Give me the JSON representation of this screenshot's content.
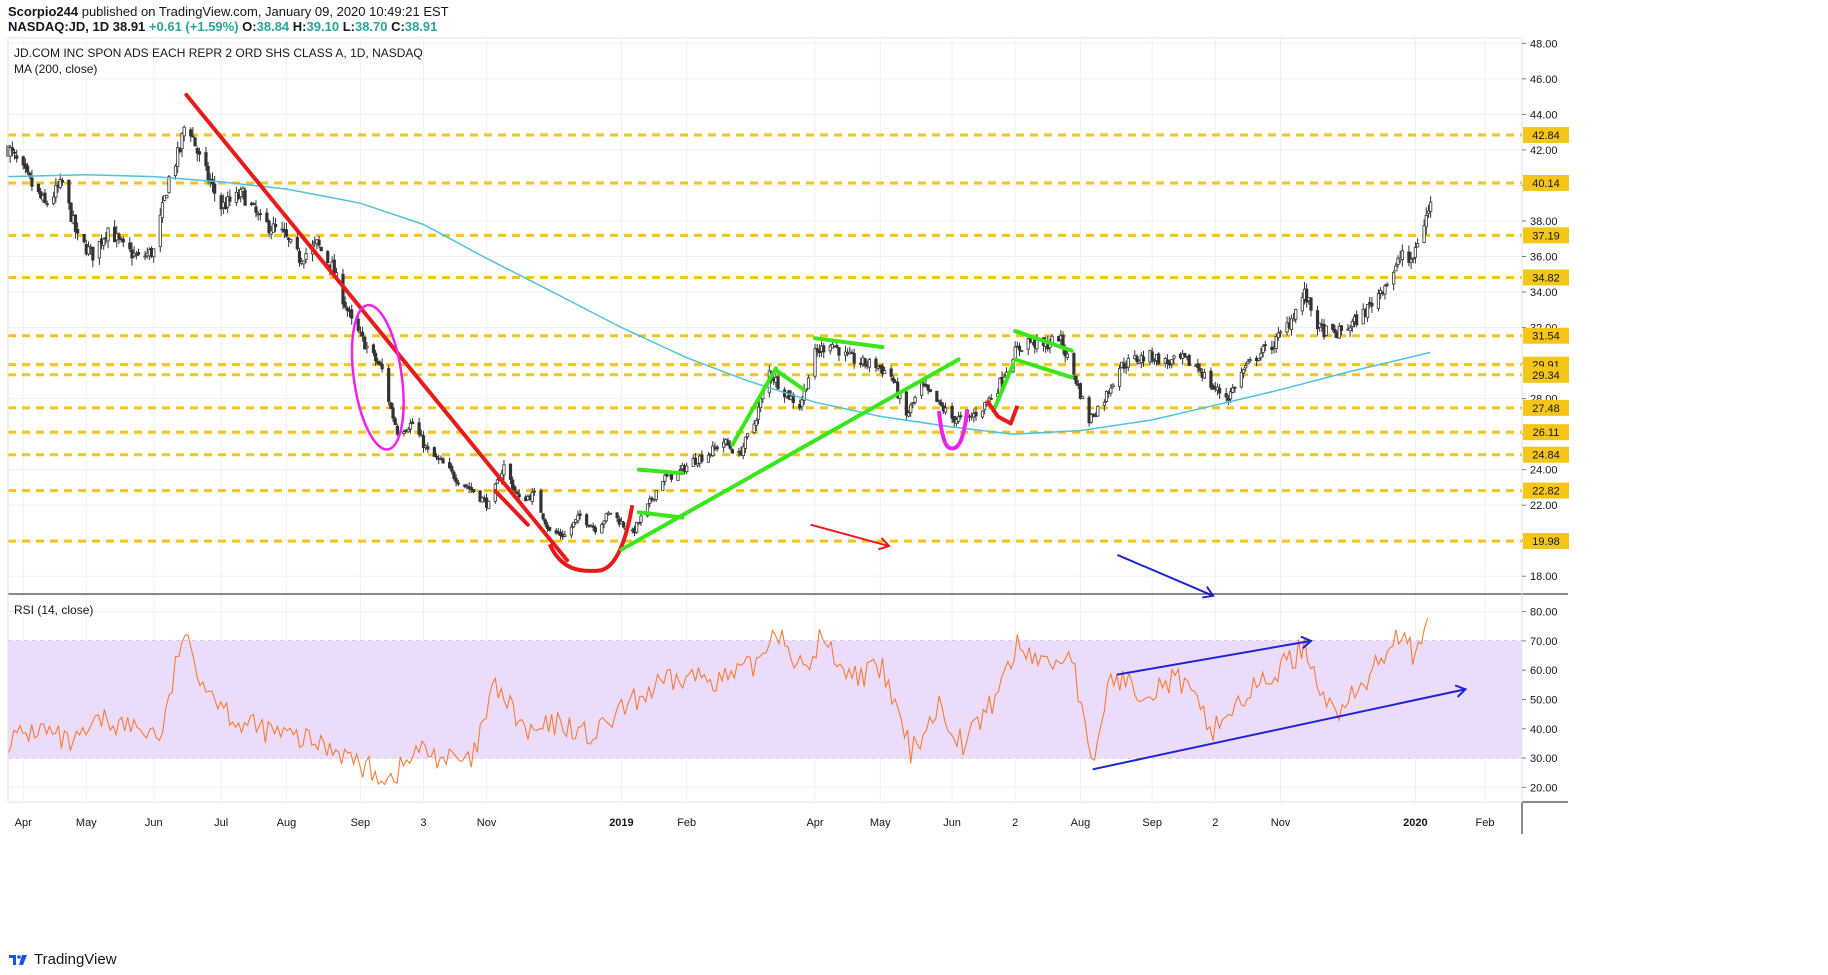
{
  "header": {
    "publisher": "Scorpio244",
    "published_text": "published on TradingView.com, January 09, 2020 10:49:21 EST",
    "symbol": "NASDAQ:JD, 1D",
    "last": "38.91",
    "change": "+0.61 (+1.59%)",
    "open_label": "O:",
    "open": "38.84",
    "high_label": "H:",
    "high": "39.10",
    "low_label": "L:",
    "low": "38.70",
    "close_label": "C:",
    "close": "38.91"
  },
  "legend": {
    "title": "JD.COM INC SPON ADS EACH REPR 2 ORD SHS CLASS A, 1D, NASDAQ",
    "ma": "MA (200, close)",
    "rsi": "RSI (14, close)"
  },
  "footer": {
    "brand": "TradingView",
    "logo_icon": "tradingview-logo-icon"
  },
  "colors": {
    "up": "#26a69a",
    "down": "#ef5350",
    "candle": "#444444",
    "ma": "#4fc3d9",
    "level": "#f5c518",
    "red_line": "#e81b1b",
    "green_line": "#39e619",
    "magenta": "#ee22ee",
    "blue_line": "#1f22d6",
    "rsi": "#f57c35",
    "rsi_band": "#ecdcfb",
    "grid": "#eef0f3"
  },
  "chart_data": {
    "type": "line",
    "price_axis": {
      "ylim": [
        17,
        48.3
      ],
      "ticks": [
        "48.00",
        "46.00",
        "44.00",
        "42.00",
        "40.00",
        "38.00",
        "36.00",
        "34.00",
        "32.00",
        "30.00",
        "28.00",
        "26.00",
        "24.00",
        "22.00",
        "20.00",
        "18.00"
      ]
    },
    "x_axis": {
      "labels": [
        {
          "text": "Apr",
          "date": "2018-04-02"
        },
        {
          "text": "May",
          "date": "2018-05-01"
        },
        {
          "text": "Jun",
          "date": "2018-06-01"
        },
        {
          "text": "Jul",
          "date": "2018-07-02"
        },
        {
          "text": "Aug",
          "date": "2018-08-01"
        },
        {
          "text": "Sep",
          "date": "2018-09-04"
        },
        {
          "text": "3",
          "date": "2018-10-03"
        },
        {
          "text": "Nov",
          "date": "2018-11-01"
        },
        {
          "text": "2019",
          "date": "2019-01-02"
        },
        {
          "text": "Feb",
          "date": "2019-02-01"
        },
        {
          "text": "Apr",
          "date": "2019-04-01"
        },
        {
          "text": "May",
          "date": "2019-05-01"
        },
        {
          "text": "Jun",
          "date": "2019-06-03"
        },
        {
          "text": "2",
          "date": "2019-07-02"
        },
        {
          "text": "Aug",
          "date": "2019-08-01"
        },
        {
          "text": "Sep",
          "date": "2019-09-03"
        },
        {
          "text": "2",
          "date": "2019-10-02"
        },
        {
          "text": "Nov",
          "date": "2019-11-01"
        },
        {
          "text": "2020",
          "date": "2020-01-02"
        },
        {
          "text": "Feb",
          "date": "2020-02-03"
        }
      ]
    },
    "levels": [
      "42.84",
      "40.14",
      "37.19",
      "34.82",
      "31.54",
      "29.91",
      "29.34",
      "27.48",
      "26.11",
      "24.84",
      "22.82",
      "19.98"
    ],
    "price_path": [
      [
        "2018-03-26",
        42.1
      ],
      [
        "2018-04-05",
        40.2
      ],
      [
        "2018-04-12",
        38.9
      ],
      [
        "2018-04-20",
        40.1
      ],
      [
        "2018-04-27",
        37.0
      ],
      [
        "2018-05-04",
        36.1
      ],
      [
        "2018-05-11",
        37.6
      ],
      [
        "2018-05-18",
        36.5
      ],
      [
        "2018-05-25",
        35.9
      ],
      [
        "2018-06-01",
        36.3
      ],
      [
        "2018-06-08",
        40.4
      ],
      [
        "2018-06-13",
        42.0
      ],
      [
        "2018-06-16",
        43.9
      ],
      [
        "2018-06-22",
        41.5
      ],
      [
        "2018-07-02",
        38.8
      ],
      [
        "2018-07-12",
        39.5
      ],
      [
        "2018-07-20",
        38.0
      ],
      [
        "2018-07-30",
        37.3
      ],
      [
        "2018-08-07",
        35.9
      ],
      [
        "2018-08-15",
        36.7
      ],
      [
        "2018-08-22",
        35.4
      ],
      [
        "2018-08-31",
        32.3
      ],
      [
        "2018-09-07",
        30.9
      ],
      [
        "2018-09-14",
        29.6
      ],
      [
        "2018-09-18",
        27.4
      ],
      [
        "2018-09-21",
        26.2
      ],
      [
        "2018-09-28",
        26.6
      ],
      [
        "2018-10-05",
        25.0
      ],
      [
        "2018-10-12",
        24.3
      ],
      [
        "2018-10-19",
        23.4
      ],
      [
        "2018-10-26",
        22.8
      ],
      [
        "2018-11-02",
        22.0
      ],
      [
        "2018-11-09",
        24.2
      ],
      [
        "2018-11-16",
        22.3
      ],
      [
        "2018-11-23",
        22.6
      ],
      [
        "2018-11-30",
        20.5
      ],
      [
        "2018-12-07",
        20.3
      ],
      [
        "2018-12-14",
        21.4
      ],
      [
        "2018-12-21",
        20.7
      ],
      [
        "2018-12-28",
        21.6
      ],
      [
        "2019-01-07",
        20.4
      ],
      [
        "2019-01-14",
        21.9
      ],
      [
        "2019-01-21",
        23.5
      ],
      [
        "2019-01-28",
        23.8
      ],
      [
        "2019-02-04",
        24.5
      ],
      [
        "2019-02-11",
        24.9
      ],
      [
        "2019-02-18",
        25.6
      ],
      [
        "2019-02-25",
        24.8
      ],
      [
        "2019-03-04",
        26.6
      ],
      [
        "2019-03-11",
        29.5
      ],
      [
        "2019-03-18",
        28.4
      ],
      [
        "2019-03-25",
        27.6
      ],
      [
        "2019-04-01",
        30.5
      ],
      [
        "2019-04-08",
        31.2
      ],
      [
        "2019-04-15",
        30.4
      ],
      [
        "2019-04-22",
        30.0
      ],
      [
        "2019-04-29",
        29.9
      ],
      [
        "2019-05-06",
        29.3
      ],
      [
        "2019-05-13",
        27.0
      ],
      [
        "2019-05-20",
        28.7
      ],
      [
        "2019-05-27",
        27.8
      ],
      [
        "2019-06-03",
        26.9
      ],
      [
        "2019-06-10",
        26.8
      ],
      [
        "2019-06-17",
        27.5
      ],
      [
        "2019-06-24",
        28.6
      ],
      [
        "2019-07-01",
        30.5
      ],
      [
        "2019-07-08",
        31.3
      ],
      [
        "2019-07-15",
        30.9
      ],
      [
        "2019-07-22",
        31.5
      ],
      [
        "2019-07-29",
        29.4
      ],
      [
        "2019-08-05",
        26.8
      ],
      [
        "2019-08-12",
        28.0
      ],
      [
        "2019-08-19",
        29.8
      ],
      [
        "2019-08-26",
        30.2
      ],
      [
        "2019-09-03",
        30.4
      ],
      [
        "2019-09-10",
        30.0
      ],
      [
        "2019-09-17",
        30.2
      ],
      [
        "2019-09-24",
        29.8
      ],
      [
        "2019-10-01",
        28.6
      ],
      [
        "2019-10-08",
        28.1
      ],
      [
        "2019-10-15",
        29.6
      ],
      [
        "2019-10-22",
        30.5
      ],
      [
        "2019-10-29",
        31.1
      ],
      [
        "2019-11-05",
        32.3
      ],
      [
        "2019-11-12",
        33.9
      ],
      [
        "2019-11-19",
        31.9
      ],
      [
        "2019-11-26",
        31.6
      ],
      [
        "2019-12-03",
        32.1
      ],
      [
        "2019-12-10",
        32.9
      ],
      [
        "2019-12-17",
        34.1
      ],
      [
        "2019-12-24",
        35.3
      ],
      [
        "2019-12-27",
        36.3
      ],
      [
        "2019-12-31",
        35.5
      ],
      [
        "2020-01-03",
        36.9
      ],
      [
        "2020-01-09",
        38.91
      ]
    ],
    "ma200_path": [
      [
        "2018-03-26",
        40.5
      ],
      [
        "2018-05-01",
        40.6
      ],
      [
        "2018-06-01",
        40.5
      ],
      [
        "2018-07-02",
        40.2
      ],
      [
        "2018-08-01",
        39.8
      ],
      [
        "2018-09-04",
        39.0
      ],
      [
        "2018-10-03",
        37.8
      ],
      [
        "2018-11-01",
        35.9
      ],
      [
        "2018-12-03",
        33.9
      ],
      [
        "2019-01-02",
        32.0
      ],
      [
        "2019-02-01",
        30.3
      ],
      [
        "2019-03-01",
        29.0
      ],
      [
        "2019-04-01",
        27.8
      ],
      [
        "2019-05-01",
        27.0
      ],
      [
        "2019-06-03",
        26.4
      ],
      [
        "2019-07-01",
        26.0
      ],
      [
        "2019-08-01",
        26.2
      ],
      [
        "2019-09-03",
        26.8
      ],
      [
        "2019-10-01",
        27.6
      ],
      [
        "2019-11-01",
        28.5
      ],
      [
        "2019-12-02",
        29.5
      ],
      [
        "2020-01-09",
        30.6
      ]
    ],
    "rsi_axis": {
      "ylim": [
        15,
        86
      ],
      "ticks": [
        "80.00",
        "70.00",
        "60.00",
        "50.00",
        "40.00",
        "30.00",
        "20.00"
      ],
      "band": [
        30,
        70
      ]
    },
    "rsi_path": [
      [
        "2018-03-26",
        36
      ],
      [
        "2018-04-10",
        40
      ],
      [
        "2018-04-25",
        34
      ],
      [
        "2018-05-08",
        43
      ],
      [
        "2018-05-20",
        41
      ],
      [
        "2018-06-05",
        38
      ],
      [
        "2018-06-14",
        72
      ],
      [
        "2018-06-25",
        55
      ],
      [
        "2018-07-10",
        42
      ],
      [
        "2018-07-25",
        39
      ],
      [
        "2018-08-10",
        36
      ],
      [
        "2018-08-25",
        33
      ],
      [
        "2018-09-05",
        27
      ],
      [
        "2018-09-18",
        23
      ],
      [
        "2018-10-01",
        33
      ],
      [
        "2018-10-12",
        30
      ],
      [
        "2018-10-25",
        28
      ],
      [
        "2018-11-05",
        55
      ],
      [
        "2018-11-20",
        38
      ],
      [
        "2018-12-05",
        42
      ],
      [
        "2018-12-20",
        37
      ],
      [
        "2019-01-05",
        48
      ],
      [
        "2019-01-20",
        55
      ],
      [
        "2019-02-05",
        58
      ],
      [
        "2019-02-20",
        57
      ],
      [
        "2019-03-05",
        62
      ],
      [
        "2019-03-14",
        75
      ],
      [
        "2019-03-28",
        58
      ],
      [
        "2019-04-03",
        71
      ],
      [
        "2019-04-18",
        58
      ],
      [
        "2019-05-02",
        60
      ],
      [
        "2019-05-15",
        32
      ],
      [
        "2019-05-28",
        48
      ],
      [
        "2019-06-08",
        35
      ],
      [
        "2019-06-20",
        47
      ],
      [
        "2019-07-03",
        68
      ],
      [
        "2019-07-18",
        62
      ],
      [
        "2019-07-28",
        66
      ],
      [
        "2019-08-06",
        26
      ],
      [
        "2019-08-15",
        58
      ],
      [
        "2019-08-30",
        53
      ],
      [
        "2019-09-15",
        57
      ],
      [
        "2019-10-01",
        40
      ],
      [
        "2019-10-14",
        50
      ],
      [
        "2019-10-28",
        58
      ],
      [
        "2019-11-12",
        68
      ],
      [
        "2019-11-25",
        45
      ],
      [
        "2019-12-08",
        53
      ],
      [
        "2019-12-20",
        68
      ],
      [
        "2019-12-28",
        75
      ],
      [
        "2020-01-02",
        62
      ],
      [
        "2020-01-09",
        78
      ]
    ],
    "annotations": [
      {
        "kind": "line",
        "color": "red_line",
        "from": [
          "2018-06-16",
          45.1
        ],
        "to": [
          "2018-12-08",
          18.9
        ]
      },
      {
        "kind": "line",
        "color": "red_line",
        "from": [
          "2018-11-05",
          22.8
        ],
        "to": [
          "2018-11-20",
          20.9
        ]
      },
      {
        "kind": "curve",
        "color": "red_line",
        "from": [
          "2018-11-30",
          19.8
        ],
        "to": [
          "2019-01-07",
          22.0
        ],
        "bottom": [
          "2018-12-20",
          18.3
        ]
      },
      {
        "kind": "ellipse",
        "color": "magenta",
        "center": [
          "2018-09-12",
          29.2
        ],
        "half_days": 11,
        "half_price": 4.1
      },
      {
        "kind": "line",
        "color": "green_line",
        "from": [
          "2019-01-02",
          19.5
        ],
        "to": [
          "2019-06-06",
          30.2
        ]
      },
      {
        "kind": "line",
        "color": "green_line",
        "from": [
          "2019-01-10",
          24.0
        ],
        "to": [
          "2019-01-30",
          23.8
        ]
      },
      {
        "kind": "line",
        "color": "green_line",
        "from": [
          "2019-01-10",
          21.6
        ],
        "to": [
          "2019-01-30",
          21.3
        ]
      },
      {
        "kind": "line",
        "color": "green_line",
        "from": [
          "2019-02-22",
          25.4
        ],
        "to": [
          "2019-03-14",
          29.7
        ]
      },
      {
        "kind": "line",
        "color": "green_line",
        "from": [
          "2019-03-14",
          29.6
        ],
        "to": [
          "2019-03-27",
          28.5
        ]
      },
      {
        "kind": "line",
        "color": "green_line",
        "from": [
          "2019-04-01",
          31.4
        ],
        "to": [
          "2019-05-02",
          30.9
        ]
      },
      {
        "kind": "line",
        "color": "green_line",
        "from": [
          "2019-06-22",
          27.3
        ],
        "to": [
          "2019-07-01",
          29.9
        ]
      },
      {
        "kind": "line",
        "color": "green_line",
        "from": [
          "2019-07-02",
          31.8
        ],
        "to": [
          "2019-07-28",
          30.7
        ]
      },
      {
        "kind": "line",
        "color": "green_line",
        "from": [
          "2019-07-02",
          30.2
        ],
        "to": [
          "2019-07-28",
          29.2
        ]
      },
      {
        "kind": "curve",
        "color": "magenta",
        "from": [
          "2019-05-28",
          27.3
        ],
        "to": [
          "2019-06-10",
          27.4
        ],
        "bottom": [
          "2019-06-03",
          25.2
        ]
      },
      {
        "kind": "polyline",
        "color": "red_line",
        "points": [
          [
            "2019-06-19",
            27.9
          ],
          [
            "2019-06-24",
            27.0
          ],
          [
            "2019-06-30",
            26.6
          ],
          [
            "2019-07-03",
            27.6
          ]
        ]
      },
      {
        "kind": "arrow",
        "color": "red_line",
        "from": [
          "2019-03-30",
          20.9
        ],
        "to": [
          "2019-05-05",
          19.7
        ]
      },
      {
        "kind": "arrow",
        "color": "blue_line",
        "from": [
          "2019-08-18",
          19.2
        ],
        "to": [
          "2019-10-01",
          16.9
        ]
      }
    ],
    "rsi_annotations": [
      {
        "kind": "line",
        "color": "blue_line",
        "from": [
          "2019-08-18",
          58.5
        ],
        "to": [
          "2019-11-15",
          70.0
        ]
      },
      {
        "kind": "line",
        "color": "blue_line",
        "from": [
          "2019-08-07",
          26.2
        ],
        "to": [
          "2020-01-25",
          53.5
        ]
      }
    ]
  }
}
